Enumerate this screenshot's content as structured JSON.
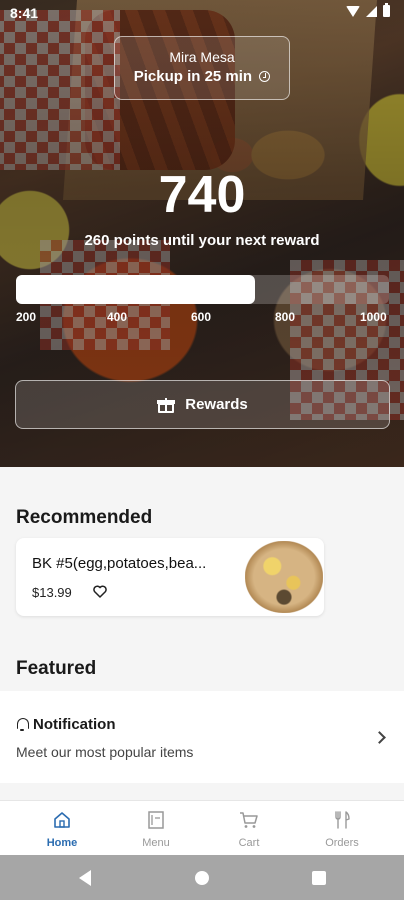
{
  "status_bar": {
    "time": "8:41"
  },
  "pickup": {
    "store": "Mira Mesa",
    "label": "Pickup in 25 min"
  },
  "rewards": {
    "points": "740",
    "message": "260 points until your next reward",
    "progress_fraction": 0.64,
    "ticks": [
      "200",
      "400",
      "600",
      "800",
      "1000"
    ],
    "button_label": "Rewards"
  },
  "recommended": {
    "title": "Recommended",
    "item": {
      "name": "BK #5(egg,potatoes,bea...",
      "price": "$13.99"
    }
  },
  "featured": {
    "title": "Featured",
    "notification": {
      "title": "Notification",
      "description": "Meet our most popular items"
    }
  },
  "nav": {
    "items": [
      {
        "label": "Home",
        "icon": "home-icon",
        "active": true
      },
      {
        "label": "Menu",
        "icon": "menu-icon",
        "active": false
      },
      {
        "label": "Cart",
        "icon": "cart-icon",
        "active": false
      },
      {
        "label": "Orders",
        "icon": "fork-knife-icon",
        "active": false
      }
    ]
  },
  "colors": {
    "accent": "#2b6cb0",
    "inactive": "#999999"
  }
}
